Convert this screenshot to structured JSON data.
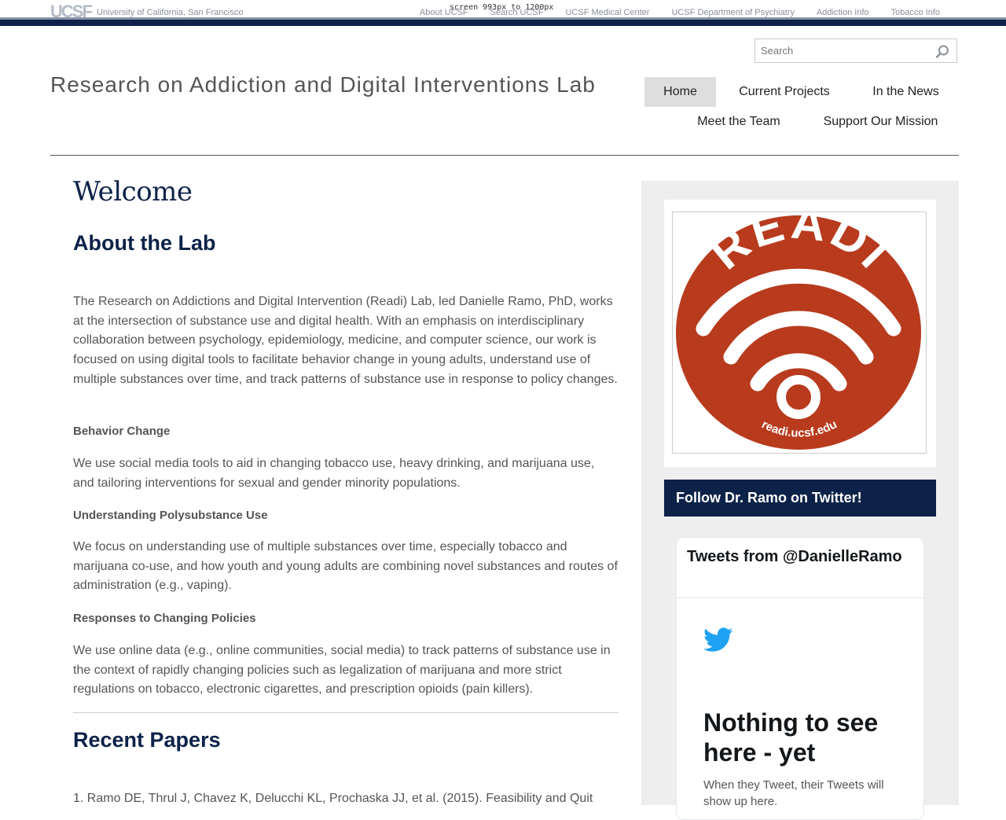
{
  "topbar": {
    "logo": "UCSF",
    "university": "University of California, San Francisco",
    "debug": "screen 993px to 1200px",
    "links": [
      "About UCSF",
      "Search UCSF",
      "UCSF Medical Center",
      "UCSF Department of Psychiatry",
      "Addiction Info",
      "Tobacco Info"
    ]
  },
  "header": {
    "search_placeholder": "Search",
    "site_title": "Research on Addiction and Digital Interventions Lab",
    "nav": [
      "Home",
      "Current Projects",
      "In the News",
      "Meet the Team",
      "Support Our Mission"
    ],
    "active_nav": "Home"
  },
  "main": {
    "welcome": "Welcome",
    "about_heading": "About the Lab",
    "about_text": "The Research on Addictions and Digital Intervention (Readi) Lab, led Danielle Ramo, PhD, works at the intersection of substance use and digital health. With an emphasis on interdisciplinary collaboration between psychology, epidemiology, medicine, and computer science, our work is focused on using digital tools to facilitate behavior change in young adults, understand use of multiple substances over time, and track patterns of substance use in response to policy changes.",
    "sections": [
      {
        "title": "Behavior Change",
        "text": "We use social media tools to aid in changing tobacco use, heavy drinking, and marijuana use, and tailoring interventions for sexual and gender minority populations."
      },
      {
        "title": "Understanding Polysubstance Use",
        "text": "We focus on understanding use of multiple substances over time, especially tobacco and marijuana co-use, and how youth and young adults are combining novel substances and routes of administration (e.g., vaping)."
      },
      {
        "title": "Responses to Changing Policies",
        "text": "We use online data (e.g., online communities, social media) to track patterns of substance use in the context of rapidly changing policies such as legalization of marijuana and more strict regulations on tobacco, electronic cigarettes, and prescription opioids (pain killers)."
      }
    ],
    "papers_heading": "Recent Papers",
    "first_paper": "1. Ramo DE, Thrul J, Chavez K, Delucchi KL, Prochaska JJ, et al. (2015). Feasibility and Quit"
  },
  "sidebar": {
    "logo_word": "READI",
    "logo_url": "readi.ucsf.edu",
    "follow_label": "Follow Dr. Ramo on Twitter!",
    "tweets_heading": "Tweets from @DanielleRamo",
    "empty_title": "Nothing to see here - yet",
    "empty_text": "When they Tweet, their Tweets will show up here."
  },
  "colors": {
    "navy": "#0c2248",
    "readi_red": "#b83b1e",
    "twitter_blue": "#1da1f2"
  }
}
